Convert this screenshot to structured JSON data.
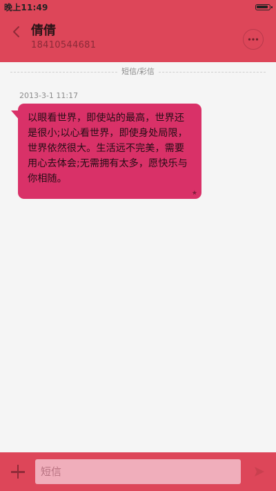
{
  "status_bar": {
    "time": "晚上11:49",
    "battery_level": 0.95
  },
  "header": {
    "contact_name": "倩倩",
    "contact_number": "18410544681",
    "back_icon": "chevron-left-icon",
    "more_icon": "more-dots-icon"
  },
  "conversation": {
    "separator_label": "短信/彩信",
    "messages": [
      {
        "timestamp": "2013-3-1 11:17",
        "text": "以眼看世界，即使站的最高，世界还是很小;以心看世界，即使身处局限，世界依然很大。生活远不完美，需要用心去体会;无需拥有太多，愿快乐与你相随。",
        "star": "★"
      }
    ]
  },
  "compose": {
    "add_icon": "plus-icon",
    "input_placeholder": "短信",
    "input_value": "",
    "send_icon": "send-icon"
  },
  "colors": {
    "accent": "#dd4659",
    "bubble": "#d93168",
    "input_bg": "#f0aebb",
    "background": "#f5f5f5"
  }
}
